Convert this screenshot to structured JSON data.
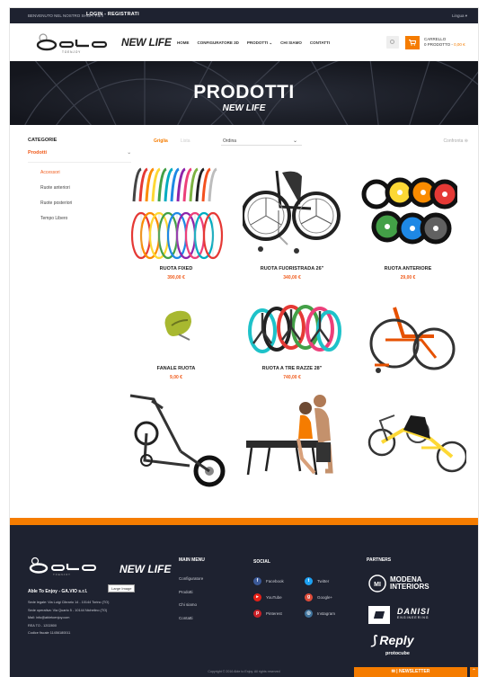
{
  "topbar": {
    "message": "BENVENUTO NEL NOSTRO SHOP! Fai il",
    "login": "LOGIN - REGISTRATI",
    "language": "Lingua"
  },
  "header": {
    "brand": "NEW LIFE",
    "nav": [
      "HOME",
      "CONFIGURATORE 3D",
      "PRODOTTI",
      "CHI SIAMO",
      "CONTATTI"
    ],
    "cart_title": "CARRELLO",
    "cart_count": "0 PRODOTTO",
    "cart_amount": "0,00 €"
  },
  "hero": {
    "title": "PRODOTTI",
    "subtitle": "NEW LIFE"
  },
  "sidebar": {
    "title": "CATEGORIE",
    "category": "Prodotti",
    "items": [
      "Accessori",
      "Ruote anteriori",
      "Ruote posteriori",
      "Tempo Libero"
    ]
  },
  "toolbar": {
    "grid": "Griglia",
    "list": "Lista",
    "sort": "Ordina",
    "compare": "Confronta"
  },
  "products": [
    {
      "name": "RUOTA FIXED",
      "price": "390,00 €"
    },
    {
      "name": "RUOTA FUORISTRADA 26\"",
      "price": "340,00 €"
    },
    {
      "name": "RUOTA ANTERIORE",
      "price": "29,00 €"
    },
    {
      "name": "FANALE RUOTA",
      "price": "9,00 €"
    },
    {
      "name": "RUOTA A TRE RAZZE 28\"",
      "price": "740,00 €"
    },
    {
      "name": "",
      "price": ""
    },
    {
      "name": "",
      "price": ""
    },
    {
      "name": "",
      "price": ""
    },
    {
      "name": "",
      "price": ""
    }
  ],
  "footer": {
    "brand": "NEW LIFE",
    "large_image": "Large Image",
    "company": "Able To Enjoy - GA.VIO s.r.l.",
    "address_lines": [
      "Sede legale: Via Luigi Cibrario 14 - 10144 Torino (TO)",
      "Sede operativa: Via Quarto 5 - 10144 Nichelino (TO)",
      "Mail: info@abletoenjoy.com",
      "REA TO - 1202800",
      "Codice fiscale 11456180011"
    ],
    "menu_title": "MAIN MENU",
    "menu": [
      "Configuratore",
      "Prodotti",
      "Chi siamo",
      "Contatti"
    ],
    "social_title": "SOCIAL",
    "social": [
      "Facebook",
      "Twitter",
      "YouTube",
      "Google+",
      "Pinterest",
      "Instagram"
    ],
    "partners_title": "PARTNERS",
    "partners": [
      "MODENA INTERIORS",
      "DANISI",
      "ENGINEERING",
      "Reply",
      "protocube"
    ],
    "copyright": "Copyright © 2016 Able to Enjoy. All rights reserved",
    "newsletter": "NEWSLETTER"
  }
}
